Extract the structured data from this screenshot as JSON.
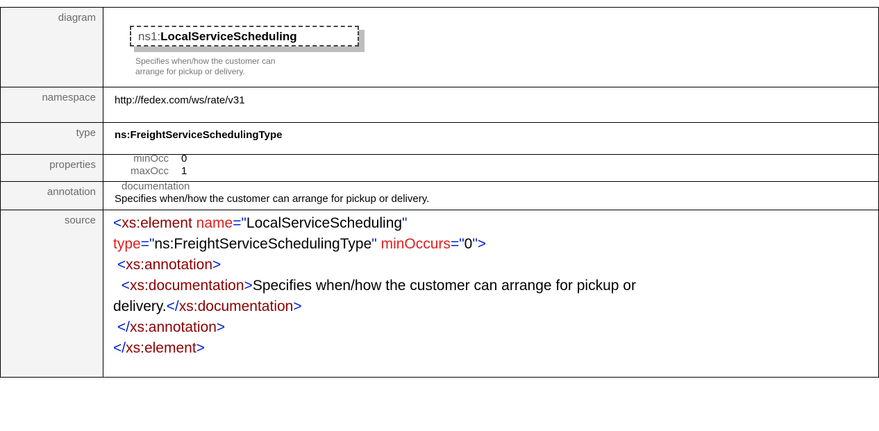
{
  "labels": {
    "diagram": "diagram",
    "namespace": "namespace",
    "type": "type",
    "properties": "properties",
    "annotation": "annotation",
    "source": "source"
  },
  "diagram": {
    "prefix": "ns1:",
    "name": "LocalServiceScheduling",
    "description": "Specifies when/how the customer can arrange for pickup or delivery."
  },
  "namespace": "http://fedex.com/ws/rate/v31",
  "type": "ns:FreightServiceSchedulingType",
  "properties": [
    {
      "key": "minOcc",
      "value": "0"
    },
    {
      "key": "maxOcc",
      "value": "1"
    }
  ],
  "annotation": {
    "heading": "documentation",
    "text": "Specifies when/how the customer can arrange for pickup or delivery."
  },
  "source": {
    "line1_tag": "xs:element",
    "line1_attr1": "name",
    "line1_val1": "LocalServiceScheduling",
    "line2_attr": "type",
    "line2_val": "ns:FreightServiceSchedulingType",
    "line2_attr2": "minOccurs",
    "line2_val2": "0",
    "ann_tag": "xs:annotation",
    "doc_tag": "xs:documentation",
    "doc_text_a": "Specifies when/how the customer can arrange for pickup or",
    "doc_text_b": "delivery.",
    "doc_close": "xs:documentation",
    "ann_close": "xs:annotation",
    "el_close": "xs:element"
  },
  "colors": {
    "tag": "#0022cc",
    "tag_name": "#8b0000",
    "attr_name": "#e02020",
    "heading": "#3a2cb4"
  }
}
